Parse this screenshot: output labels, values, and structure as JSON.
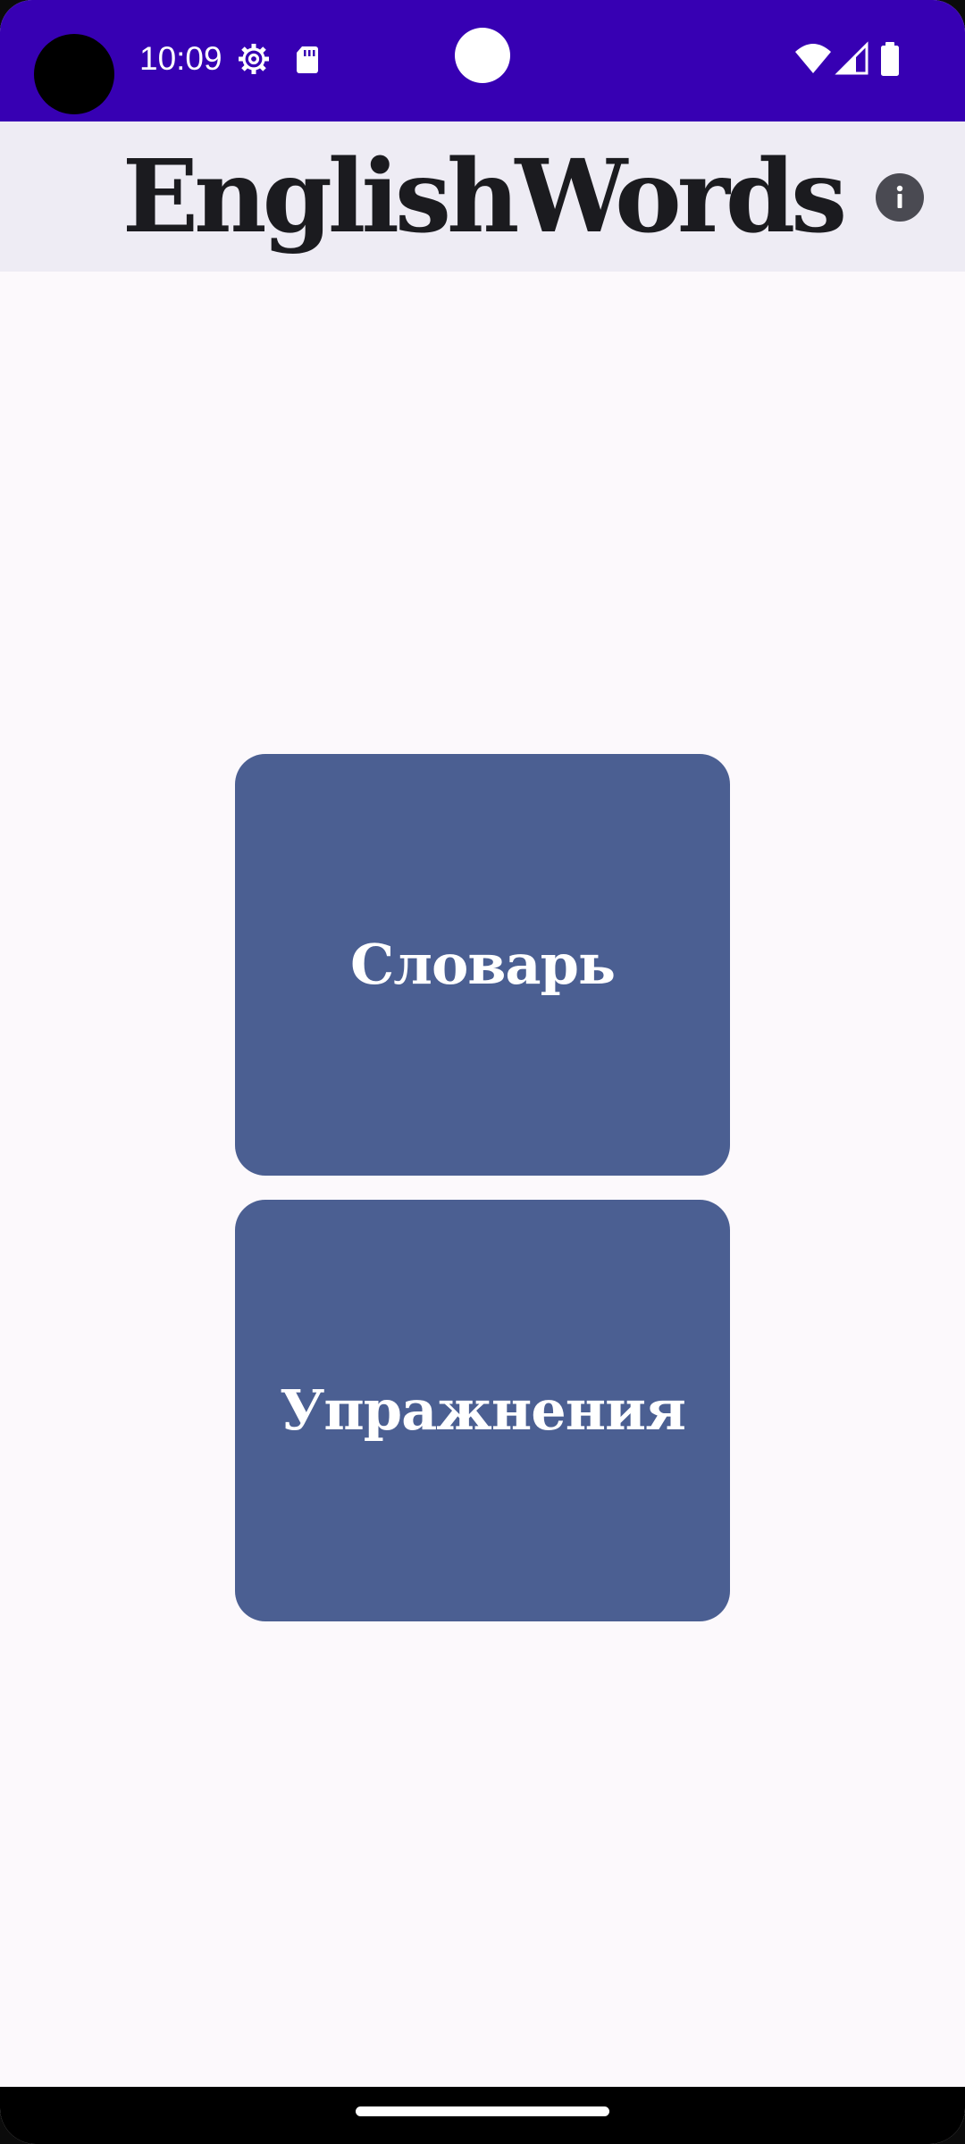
{
  "status_bar": {
    "time": "10:09",
    "background_color": "#3700B3",
    "icons_left": [
      "settings-gear-icon",
      "sd-card-icon"
    ],
    "icons_right": [
      "wifi-icon",
      "cellular-signal-icon",
      "battery-icon"
    ]
  },
  "app_bar": {
    "title": "EnglishWords",
    "info_icon": "info-icon",
    "background_color": "#EEECF4"
  },
  "menu": {
    "items": [
      {
        "label": "Словарь"
      },
      {
        "label": "Упражнения"
      }
    ],
    "card_color": "#4B5F92"
  },
  "theme": {
    "background": "#FCF9FC",
    "title_color": "#1B1B1F"
  }
}
